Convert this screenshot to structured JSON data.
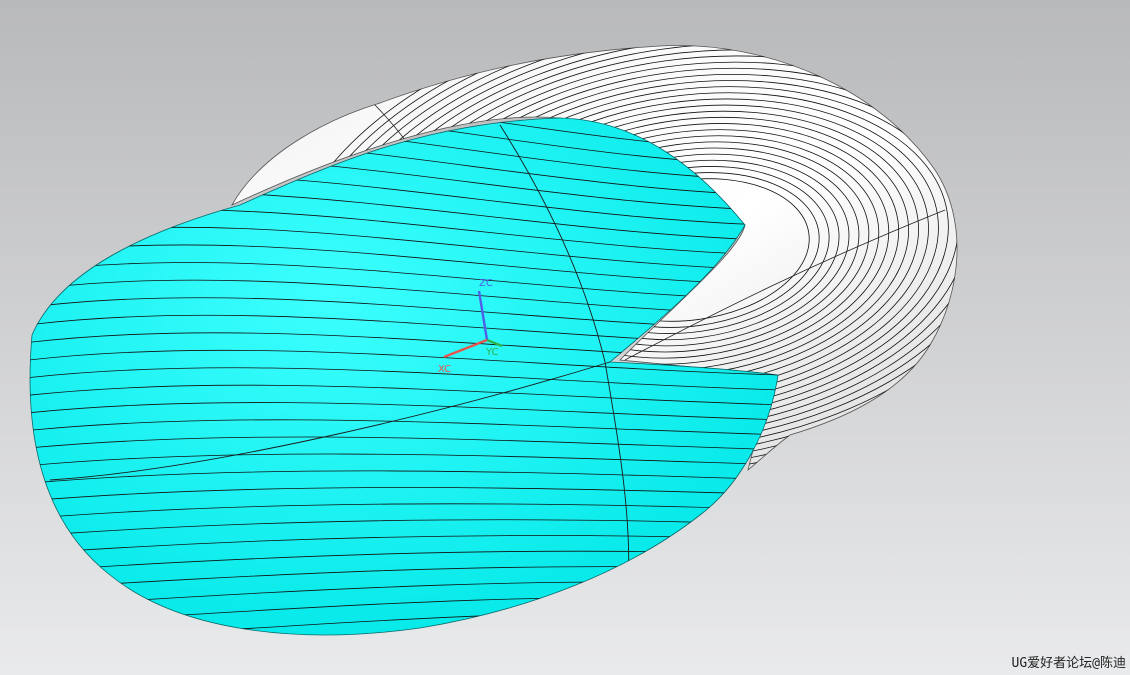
{
  "viewport": {
    "background_top": "#b8b9bb",
    "background_bottom": "#e9eaec",
    "selected_face_color": "#00ffff",
    "unselected_face_color": "#ffffff",
    "isoline_color": "#111111",
    "isoline_count_body": 34,
    "isoline_count_tube": 30
  },
  "triad": {
    "zc_label": "ZC",
    "yc_label": "YC",
    "xc_label": "XC",
    "zc_color": "#4f5fe8",
    "yc_color": "#2db34a",
    "xc_color": "#e5534b"
  },
  "watermark": {
    "text": "UG爱好者论坛@陈迪"
  }
}
